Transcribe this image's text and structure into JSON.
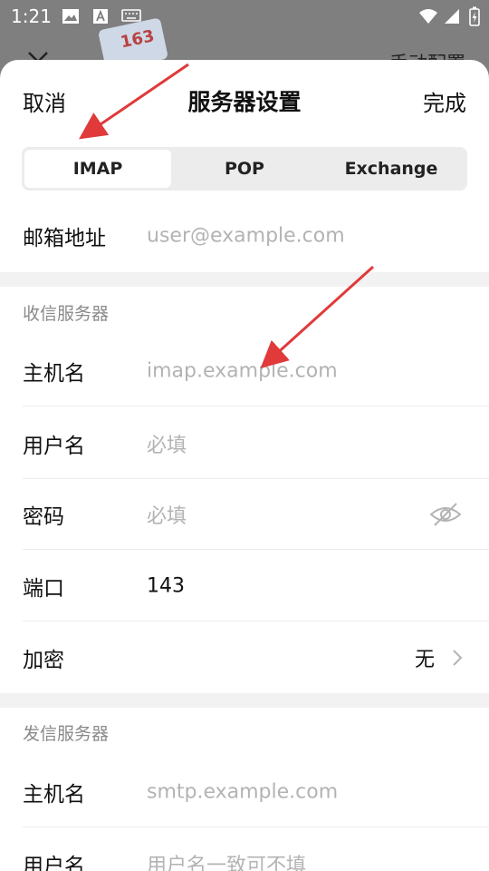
{
  "status_bar": {
    "time": "1:21"
  },
  "background": {
    "title": "手动配置",
    "logo_text": "163"
  },
  "header": {
    "cancel": "取消",
    "title": "服务器设置",
    "done": "完成"
  },
  "tabs": [
    {
      "label": "IMAP",
      "active": true
    },
    {
      "label": "POP",
      "active": false
    },
    {
      "label": "Exchange",
      "active": false
    }
  ],
  "email": {
    "label": "邮箱地址",
    "placeholder": "user@example.com"
  },
  "incoming": {
    "section": "收信服务器",
    "host": {
      "label": "主机名",
      "placeholder": "imap.example.com"
    },
    "username": {
      "label": "用户名",
      "placeholder": "必填"
    },
    "password": {
      "label": "密码",
      "placeholder": "必填"
    },
    "port": {
      "label": "端口",
      "value": "143"
    },
    "encryption": {
      "label": "加密",
      "value": "无"
    }
  },
  "outgoing": {
    "section": "发信服务器",
    "host": {
      "label": "主机名",
      "placeholder": "smtp.example.com"
    },
    "username": {
      "label": "用户名",
      "placeholder": "用户名一致可不填"
    }
  },
  "colors": {
    "arrow": "#e03a3a",
    "placeholder": "#b3b3b3",
    "section_gap": "#f2f2f2"
  }
}
